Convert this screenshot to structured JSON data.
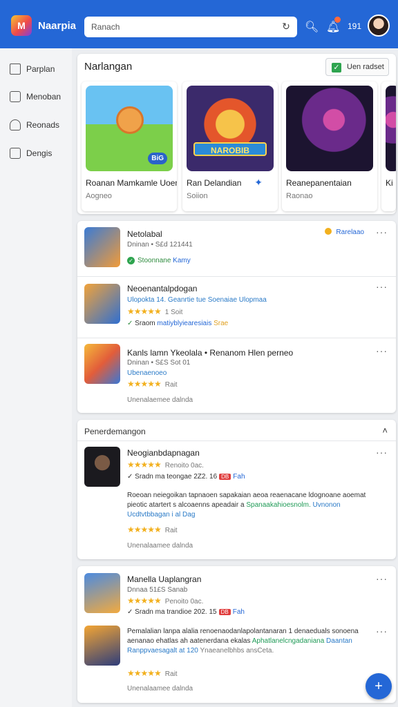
{
  "app": {
    "logo": "M",
    "name": "Naarpia"
  },
  "search": {
    "value": "Ranach"
  },
  "topbar": {
    "count": "191"
  },
  "sidebar": {
    "items": [
      {
        "label": "Parplan"
      },
      {
        "label": "Menoban"
      },
      {
        "label": "Reonads"
      },
      {
        "label": "Dengis"
      }
    ]
  },
  "featured": {
    "title": "Narlangan",
    "button": "Uen radset",
    "cards": [
      {
        "title": "Roanan Mamkamle Uoen",
        "sub": "Aogneo",
        "badge": "BiG"
      },
      {
        "title": "Ran Delandian",
        "sub": "Soiion",
        "banner": "NAROBIB"
      },
      {
        "title": "Reanepanentaian",
        "sub": "Raonao"
      },
      {
        "title": "Ki",
        "sub": ""
      }
    ]
  },
  "list": {
    "tags": "Rarelaao",
    "rows": [
      {
        "name": "Netolabal",
        "meta": "Dninan • S£d 121441",
        "status": "Stoonnane",
        "status2": "Kamy"
      },
      {
        "name": "Neoenantalpdogan",
        "meta": "Ulopokta 14. Geanrtie tue Soenaiae Ulopmaa",
        "rating": "1 Soit",
        "status": "Sraom",
        "status2": "matiyblyiearesiais",
        "status3": "Srae"
      },
      {
        "name": "Kanls lamn Ykeolala • Renanom Hlen perneo",
        "meta": "Dninan • S£S Sot 01",
        "blue": "Ubenaenoeo",
        "rating": "Rait",
        "dim": "Unenalaemee dalnda"
      }
    ]
  },
  "section2": {
    "header": "Penerdemangon",
    "rows": [
      {
        "name": "Neogianbdapnagan",
        "rating": "Renoito 0ac.",
        "status": "Sradn ma teongae 2Z2. 16",
        "tag": "DB",
        "tail": "Fah",
        "desc": "Roeoan neiegoikan tapnaoen sapakaian aeoa reaenacane ldognoane aoemat pieotic atartert s alcoaenns apeadair a",
        "desc_hl": "Spanaakahioesnolm.",
        "desc_b": "Uvnonon Ucdtvtbbagan i al Dag",
        "rating2": "Rait",
        "dim": "Unenalaamee dalnda"
      }
    ]
  },
  "section3": {
    "rows": [
      {
        "name": "Manella Uaplangran",
        "meta": "Dnnaa 51£S Sanab",
        "rating": "Penoito 0ac.",
        "status": "Sradn ma trandioe 202. 15",
        "tag": "DB",
        "tail": "Fah"
      },
      {
        "desc": "Pemalalian lanpa alalia renoenaodanlapolantanaran 1 denaeduals sonoena aenanao ehatlas ah aatenerdana ekalas",
        "desc_hl": "Aphatlanelcngadaniana",
        "desc_b": "Daantan Ranppvaesagalt at 120",
        "desc2": "Ynaeanelbhbs ansCeta.",
        "rating2": "Rait",
        "dim": "Unenalaamee dalnda"
      }
    ]
  }
}
